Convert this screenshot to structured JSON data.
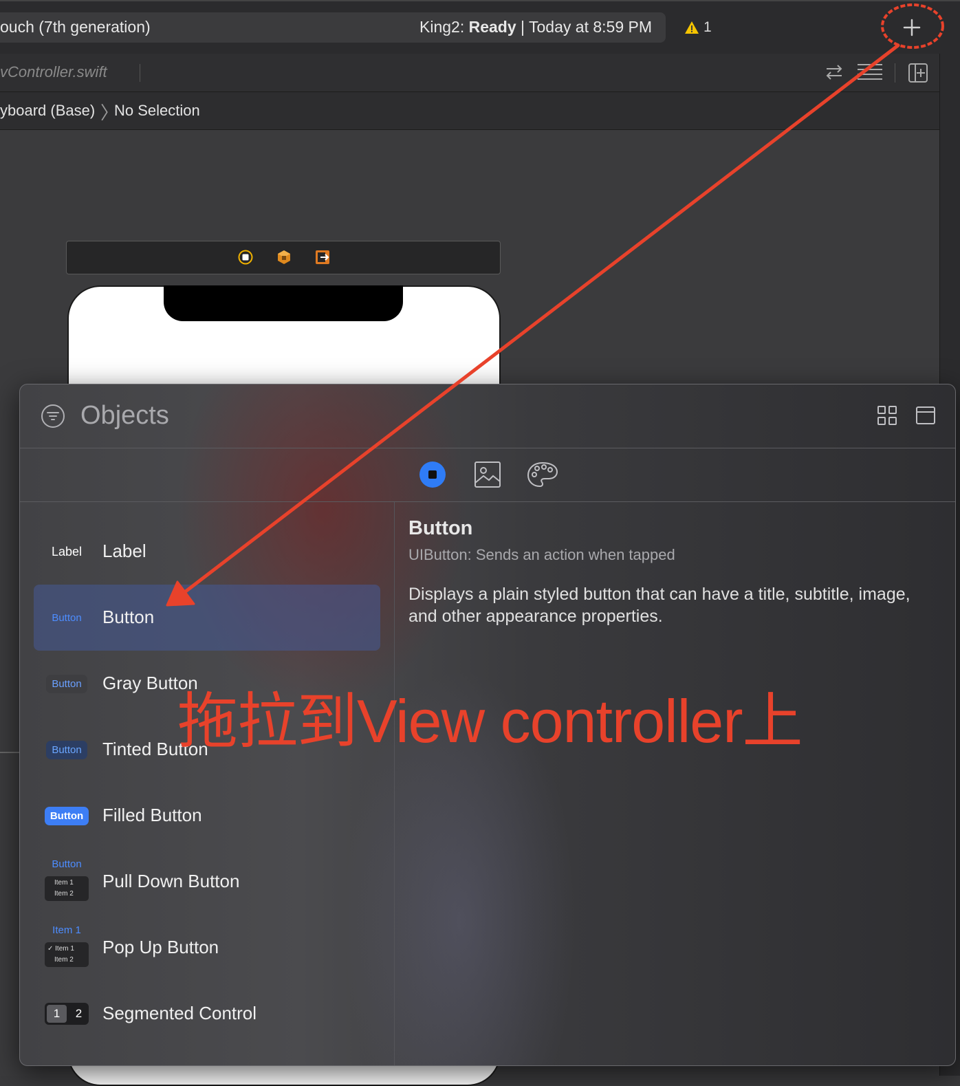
{
  "toolbar": {
    "device": "ouch (7th generation)",
    "status_project": "King2:",
    "status_state": "Ready",
    "status_sep": "|",
    "status_time": "Today at 8:59 PM",
    "warning_count": "1"
  },
  "tabbar": {
    "file": "vController.swift"
  },
  "jumpbar": {
    "crumb1": "yboard (Base)",
    "crumb_chevron": "〉",
    "crumb2": "No Selection"
  },
  "library": {
    "title": "Objects",
    "items": [
      {
        "thumb": "Label",
        "name": "Label"
      },
      {
        "thumb": "Button",
        "name": "Button"
      },
      {
        "thumb": "Button",
        "name": "Gray Button"
      },
      {
        "thumb": "Button",
        "name": "Tinted Button"
      },
      {
        "thumb": "Button",
        "name": "Filled Button"
      },
      {
        "thumb": "Button",
        "thumb_item1": "Item 1",
        "thumb_item2": "Item 2",
        "name": "Pull Down Button"
      },
      {
        "thumb": "Item 1",
        "thumb_item1": "✓ Item 1",
        "thumb_item2": "Item 2",
        "name": "Pop Up Button"
      },
      {
        "thumb_seg1": "1",
        "thumb_seg2": "2",
        "name": "Segmented Control"
      }
    ],
    "detail": {
      "title": "Button",
      "subtitle": "UIButton: Sends an action when tapped",
      "description": "Displays a plain styled button that can have a title, subtitle, image, and other appearance properties."
    }
  },
  "annotation": {
    "text": "拖拉到View controller上",
    "color": "#e8422b"
  },
  "colors": {
    "accent_blue": "#2f7cf6",
    "selection": "#465a96",
    "warning_yellow": "#f5c400"
  }
}
